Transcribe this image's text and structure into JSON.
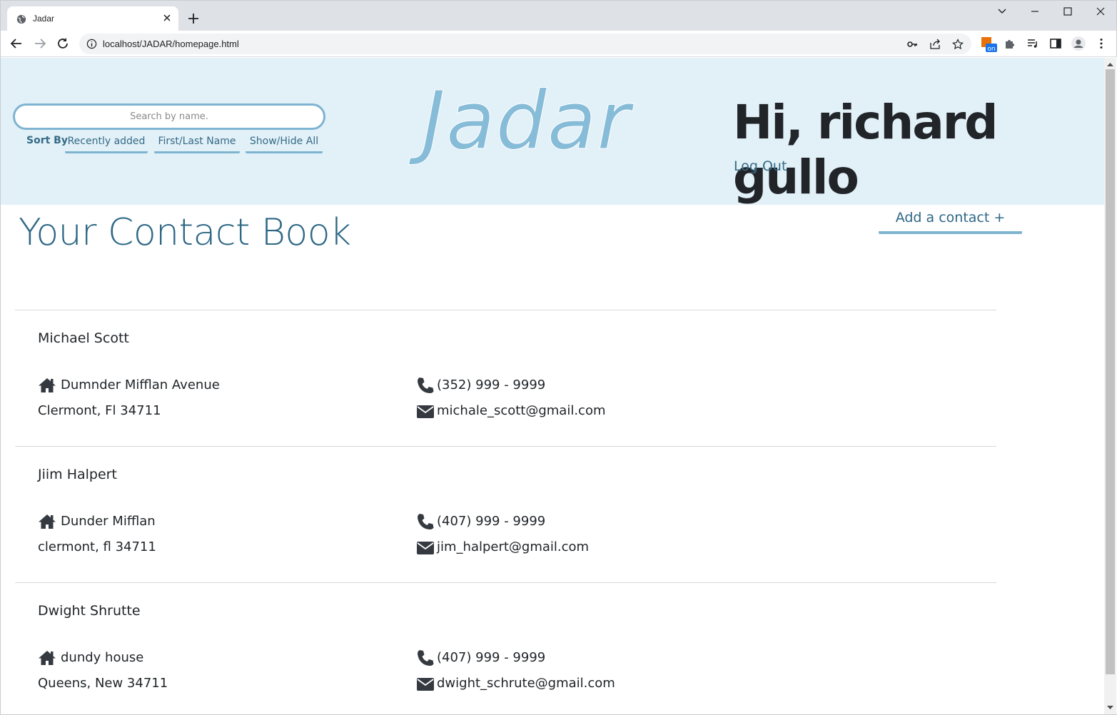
{
  "browser": {
    "tab_title": "Jadar",
    "url": "localhost/JADAR/homepage.html"
  },
  "header": {
    "search_placeholder": "Search by name.",
    "sort_label": "Sort By",
    "sort_options": [
      "Recently added",
      "First/Last Name",
      "Show/Hide All"
    ],
    "logo": "Jadar",
    "greeting": "Hi, richard gullo",
    "logout": "Log Out"
  },
  "main": {
    "title": "Your Contact Book",
    "add_contact": "Add a contact  +"
  },
  "contacts": [
    {
      "name": "Michael Scott",
      "address_line1": "Dumnder Mifflan Avenue",
      "address_line2": "Clermont, Fl 34711",
      "phone": "(352) 999 - 9999",
      "email": "michale_scott@gmail.com"
    },
    {
      "name": "Jiim Halpert",
      "address_line1": "Dunder Mifflan",
      "address_line2": "clermont, fl 34711",
      "phone": "(407) 999 - 9999",
      "email": "jim_halpert@gmail.com"
    },
    {
      "name": "Dwight Shrutte",
      "address_line1": "dundy house",
      "address_line2": "Queens, New 34711",
      "phone": "(407) 999 - 9999",
      "email": "dwight_schrute@gmail.com"
    }
  ],
  "colors": {
    "header_bg": "#e2f0f8",
    "accent": "#7eb4d0",
    "title_text": "#2d6785",
    "logo": "#86bcd7"
  }
}
